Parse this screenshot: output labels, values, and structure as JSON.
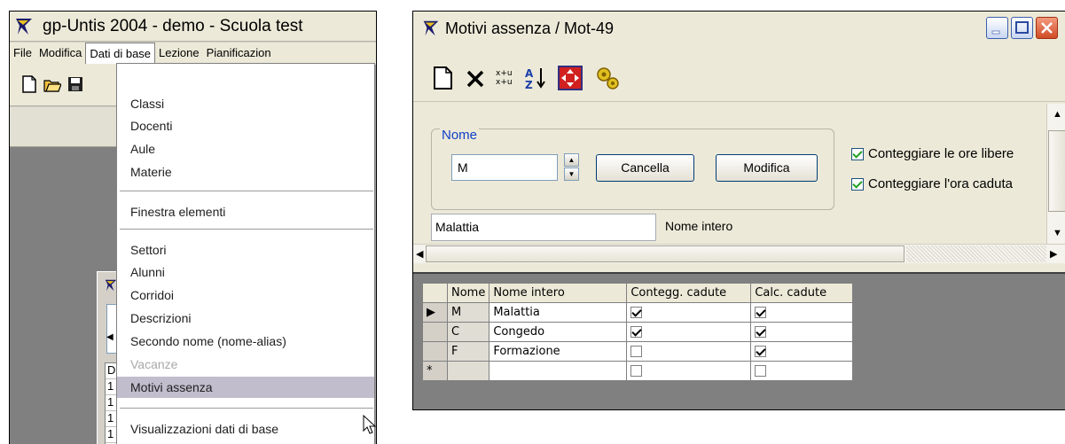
{
  "left_window": {
    "title": "gp-Untis 2004 - demo  -  Scuola test",
    "menu": [
      "File",
      "Modifica",
      "Dati di base",
      "Lezione",
      "Pianificazion"
    ],
    "dropdown": {
      "group1": [
        "Classi",
        "Docenti",
        "Aule",
        "Materie"
      ],
      "group2": [
        "Finestra elementi"
      ],
      "group3": [
        "Settori",
        "Alunni",
        "Corridoi",
        "Descrizioni",
        "Secondo nome (nome-alias)",
        "Vacanze",
        "Motivi assenza"
      ],
      "group4": [
        "Visualizzazioni dati di base"
      ],
      "disabled_item": "Vacanze",
      "selected_item": "Motivi assenza"
    },
    "child_grid_rows": [
      "D",
      "1",
      "1",
      "1",
      "1"
    ]
  },
  "right_window": {
    "title": "Motivi assenza / Mot-49",
    "name_group_label": "Nome",
    "name_value": "M",
    "cancel_button": "Cancella",
    "modify_button": "Modifica",
    "option1_label": "Conteggiare le ore libere",
    "option1_checked": true,
    "option2_label": "Conteggiare l'ora caduta",
    "option2_checked": true,
    "fullname_value": "Malattia",
    "fullname_label": "Nome intero",
    "table": {
      "headers": [
        "Nome",
        "Nome intero",
        "Contegg. cadute",
        "Calc. cadute"
      ],
      "rows": [
        {
          "marker": "▶",
          "code": "M",
          "name": "Malattia",
          "contegg": true,
          "calc": true
        },
        {
          "marker": "",
          "code": "C",
          "name": "Congedo",
          "contegg": true,
          "calc": true
        },
        {
          "marker": "",
          "code": "F",
          "name": "Formazione",
          "contegg": false,
          "calc": true
        },
        {
          "marker": "*",
          "code": "",
          "name": "",
          "contegg": false,
          "calc": false
        }
      ]
    }
  }
}
